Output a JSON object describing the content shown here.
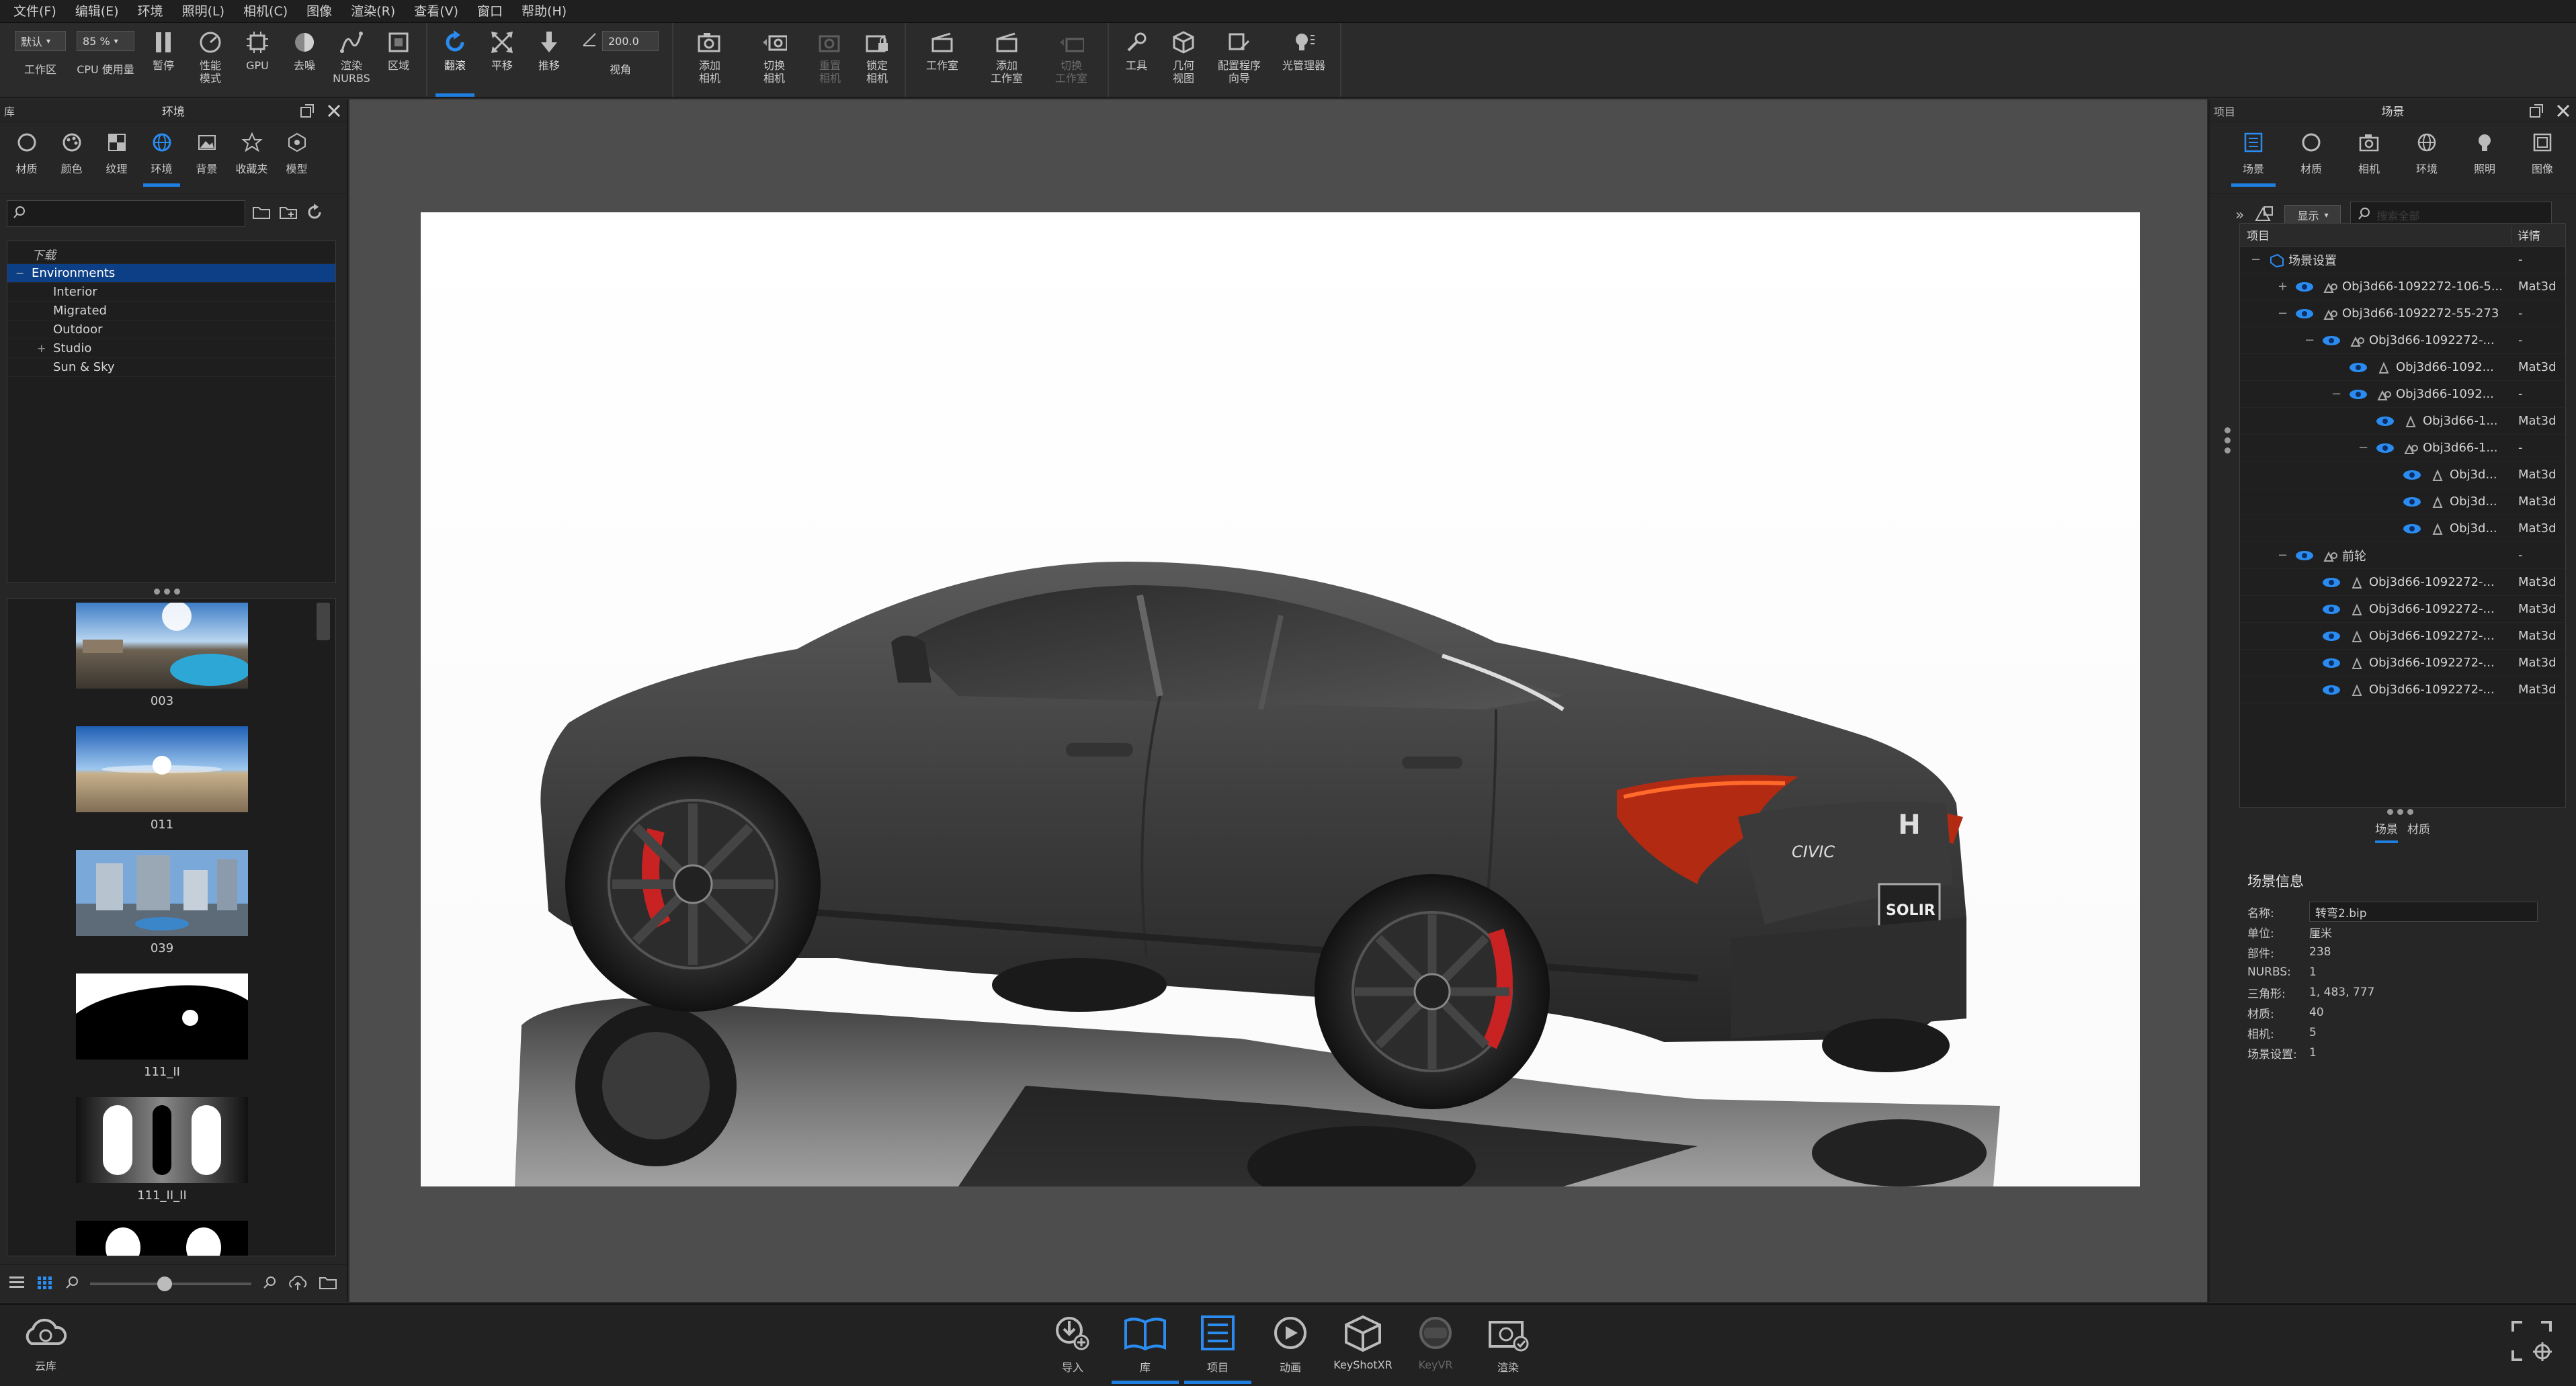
{
  "menu": [
    "文件(F)",
    "编辑(E)",
    "环境",
    "照明(L)",
    "相机(C)",
    "图像",
    "渲染(R)",
    "查看(V)",
    "窗口",
    "帮助(H)"
  ],
  "ribbon": {
    "workspace_select": "默认",
    "workspace_label": "工作区",
    "cpu_select": "85 %",
    "cpu_label": "CPU 使用量",
    "pause": "暂停",
    "perf_mode": "性能\n模式",
    "gpu": "GPU",
    "denoise": "去噪",
    "render_nurbs": "渲染\nNURBS",
    "region": "区域",
    "tumble": "翻滚",
    "pan": "平移",
    "dolly": "推移",
    "fov_value": "200.0",
    "fov_label": "视角",
    "add_camera": "添加\n相机",
    "switch_camera": "切换\n相机",
    "reset_camera": "重置\n相机",
    "lock_camera": "锁定\n相机",
    "studio": "工作室",
    "add_studio": "添加\n工作室",
    "switch_studio": "切换\n工作室",
    "tools": "工具",
    "geometry_view": "几何\n视图",
    "config_wizard": "配置程序\n向导",
    "light_manager": "光管理器"
  },
  "left_panel": {
    "header_left": "库",
    "header_title": "环境",
    "tabs": [
      "材质",
      "颜色",
      "纹理",
      "环境",
      "背景",
      "收藏夹",
      "模型"
    ],
    "active_tab": "环境",
    "tree": [
      {
        "label": "下载",
        "style": "italic",
        "level": 1
      },
      {
        "label": "Environments",
        "style": "selected",
        "level": 1
      },
      {
        "label": "Interior",
        "level": 2
      },
      {
        "label": "Migrated",
        "level": 2
      },
      {
        "label": "Outdoor",
        "level": 2
      },
      {
        "label": "Studio",
        "level": 2,
        "expandable": true
      },
      {
        "label": "Sun & Sky",
        "level": 2
      }
    ],
    "thumbnails": [
      "003",
      "011",
      "039",
      "111_II",
      "111_II_II"
    ]
  },
  "right_panel": {
    "header_left": "项目",
    "header_title": "场景",
    "tabs": [
      "场景",
      "材质",
      "相机",
      "环境",
      "照明",
      "图像"
    ],
    "active_tab": "场景",
    "show_label": "显示",
    "search_placeholder": "搜索全部",
    "col_item": "项目",
    "col_detail": "详情",
    "scene_rows": [
      {
        "name": "场景设置",
        "detail": "-",
        "level": 0,
        "type": "root"
      },
      {
        "name": "Obj3d66-1092272-106-5...",
        "detail": "Mat3d",
        "level": 1,
        "toggle": "+"
      },
      {
        "name": "Obj3d66-1092272-55-273",
        "detail": "-",
        "level": 1,
        "toggle": "−"
      },
      {
        "name": "Obj3d66-1092272-...",
        "detail": "-",
        "level": 2,
        "toggle": "−"
      },
      {
        "name": "Obj3d66-1092...",
        "detail": "Mat3d",
        "level": 3
      },
      {
        "name": "Obj3d66-1092...",
        "detail": "-",
        "level": 3,
        "toggle": "−"
      },
      {
        "name": "Obj3d66-1...",
        "detail": "Mat3d",
        "level": 4
      },
      {
        "name": "Obj3d66-1...",
        "detail": "-",
        "level": 4,
        "toggle": "−"
      },
      {
        "name": "Obj3d...",
        "detail": "Mat3d",
        "level": 5
      },
      {
        "name": "Obj3d...",
        "detail": "Mat3d",
        "level": 5
      },
      {
        "name": "Obj3d...",
        "detail": "Mat3d",
        "level": 5
      },
      {
        "name": "前轮",
        "detail": "-",
        "level": 1,
        "toggle": "−"
      },
      {
        "name": "Obj3d66-1092272-...",
        "detail": "Mat3d",
        "level": 2
      },
      {
        "name": "Obj3d66-1092272-...",
        "detail": "Mat3d",
        "level": 2
      },
      {
        "name": "Obj3d66-1092272-...",
        "detail": "Mat3d",
        "level": 2
      },
      {
        "name": "Obj3d66-1092272-...",
        "detail": "Mat3d",
        "level": 2
      },
      {
        "name": "Obj3d66-1092272-...",
        "detail": "Mat3d",
        "level": 2
      }
    ],
    "subtabs": [
      "场景",
      "材质"
    ],
    "active_subtab": "场景",
    "scene_info": {
      "title": "场景信息",
      "name_label": "名称:",
      "name_value": "转弯2.bip",
      "rows": [
        {
          "k": "单位:",
          "v": "厘米"
        },
        {
          "k": "部件:",
          "v": "238"
        },
        {
          "k": "NURBS:",
          "v": "1"
        },
        {
          "k": "三角形:",
          "v": "1, 483, 777"
        },
        {
          "k": "材质:",
          "v": "40"
        },
        {
          "k": "相机:",
          "v": "5"
        },
        {
          "k": "场景设置:",
          "v": "1"
        }
      ]
    }
  },
  "bottom_bar": {
    "cloud": "云库",
    "buttons": [
      "导入",
      "库",
      "项目",
      "动画",
      "KeyShotXR",
      "KeyVR",
      "渲染"
    ]
  },
  "render_car": {
    "badge": "CIVIC",
    "plate": "SOLIR"
  },
  "colors": {
    "accent": "#1f7fe0",
    "selection": "#0d3f86",
    "car_body": "#444444"
  }
}
